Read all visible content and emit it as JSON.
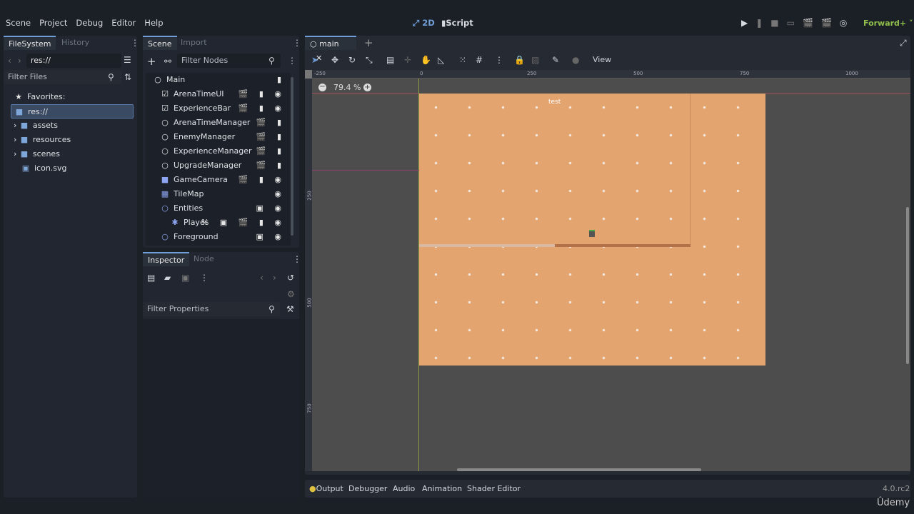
{
  "menu": [
    "Scene",
    "Project",
    "Debug",
    "Editor",
    "Help"
  ],
  "center_tabs": {
    "twod": "2D",
    "script": "Script"
  },
  "renderer": "Forward+",
  "filesystem": {
    "tabs": [
      "FileSystem",
      "History"
    ],
    "path": "res://",
    "filter_placeholder": "Filter Files",
    "favorites": "Favorites:",
    "root": "res://",
    "items": [
      {
        "name": "assets",
        "type": "folder"
      },
      {
        "name": "resources",
        "type": "folder"
      },
      {
        "name": "scenes",
        "type": "folder"
      },
      {
        "name": "icon.svg",
        "type": "file"
      }
    ]
  },
  "scene": {
    "tabs": [
      "Scene",
      "Import"
    ],
    "filter_placeholder": "Filter Nodes",
    "nodes": [
      {
        "name": "Main",
        "icon": "○",
        "badges": "▮"
      },
      {
        "name": "ArenaTimeUI",
        "icon": "☑",
        "badges": "🎬 ▮ ◉"
      },
      {
        "name": "ExperienceBar",
        "icon": "☑",
        "badges": "🎬 ▮ ◉"
      },
      {
        "name": "ArenaTimeManager",
        "icon": "○",
        "badges": "🎬 ▮"
      },
      {
        "name": "EnemyManager",
        "icon": "○",
        "badges": "🎬 ▮"
      },
      {
        "name": "ExperienceManager",
        "icon": "○",
        "badges": "🎬 ▮"
      },
      {
        "name": "UpgradeManager",
        "icon": "○",
        "badges": "🎬 ▮"
      },
      {
        "name": "GameCamera",
        "icon": "■",
        "badges": "🎬 ▮ ◉"
      },
      {
        "name": "TileMap",
        "icon": "▦",
        "badges": "◉"
      },
      {
        "name": "Entities",
        "icon": "○",
        "badges": "▣ ◉"
      },
      {
        "name": "Player",
        "icon": "✱",
        "badges": "% ▣ 🎬 ▮ ◉"
      },
      {
        "name": "Foreground",
        "icon": "○",
        "badges": "▣ ◉"
      }
    ]
  },
  "inspector": {
    "tabs": [
      "Inspector",
      "Node"
    ],
    "filter_placeholder": "Filter Properties"
  },
  "editor": {
    "tab": "main",
    "view_label": "View",
    "zoom": "79.4 %",
    "ruler": [
      "-250",
      "0",
      "250",
      "500",
      "750",
      "1000"
    ],
    "vruler": [
      "250",
      "500",
      "750"
    ],
    "label_test": "test"
  },
  "bottom": {
    "tabs": [
      "Output",
      "Debugger",
      "Audio",
      "Animation",
      "Shader Editor"
    ],
    "version": "4.0.rc2"
  },
  "watermark": "Ûdemy",
  "colors": {
    "accent": "#6f9ed8",
    "renderer": "#8fbf4a",
    "ground": "#e3a46f",
    "viewport": "#4d4d4d"
  }
}
